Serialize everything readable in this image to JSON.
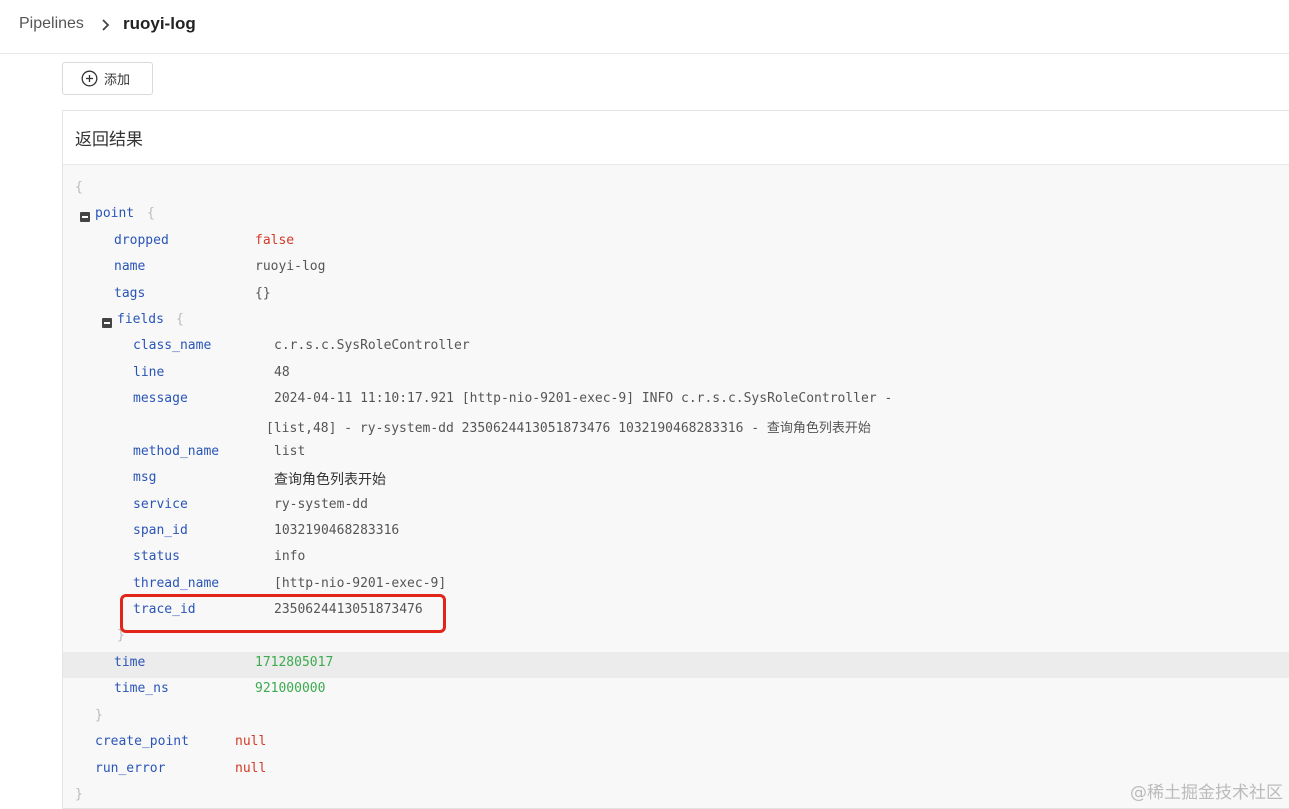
{
  "breadcrumb": {
    "root": "Pipelines",
    "current": "ruoyi-log"
  },
  "toolbar": {
    "add_label": "添加"
  },
  "panel": {
    "title": "返回结果"
  },
  "json": {
    "open_brace": "{",
    "point_key": "point",
    "point_open": "{",
    "dropped_key": "dropped",
    "dropped_val": "false",
    "name_key": "name",
    "name_val": "ruoyi-log",
    "tags_key": "tags",
    "tags_val": "{}",
    "fields_key": "fields",
    "fields_open": "{",
    "class_name_key": "class_name",
    "class_name_val": "c.r.s.c.SysRoleController",
    "line_key": "line",
    "line_val": "48",
    "message_key": "message",
    "message_val_1": "2024-04-11 11:10:17.921 [http-nio-9201-exec-9] INFO  c.r.s.c.SysRoleController -",
    "message_val_2": "[list,48] - ry-system-dd 2350624413051873476 1032190468283316 - 查询角色列表开始",
    "method_name_key": "method_name",
    "method_name_val": "list",
    "msg_key": "msg",
    "msg_val": "查询角色列表开始",
    "service_key": "service",
    "service_val": "ry-system-dd",
    "span_id_key": "span_id",
    "span_id_val": "1032190468283316",
    "status_key": "status",
    "status_val": "info",
    "thread_name_key": "thread_name",
    "thread_name_val": "[http-nio-9201-exec-9]",
    "trace_id_key": "trace_id",
    "trace_id_val": "2350624413051873476",
    "fields_close": "}",
    "time_key": "time",
    "time_val": "1712805017",
    "time_ns_key": "time_ns",
    "time_ns_val": "921000000",
    "point_close": "}",
    "create_point_key": "create_point",
    "create_point_val": "null",
    "run_error_key": "run_error",
    "run_error_val": "null",
    "close_brace": "}"
  },
  "watermark": "@稀土掘金技术社区",
  "colors": {
    "key": "#2a55b8",
    "false_null": "#d23a28",
    "number": "#3cab4f",
    "highlight_box": "#e1251b"
  }
}
